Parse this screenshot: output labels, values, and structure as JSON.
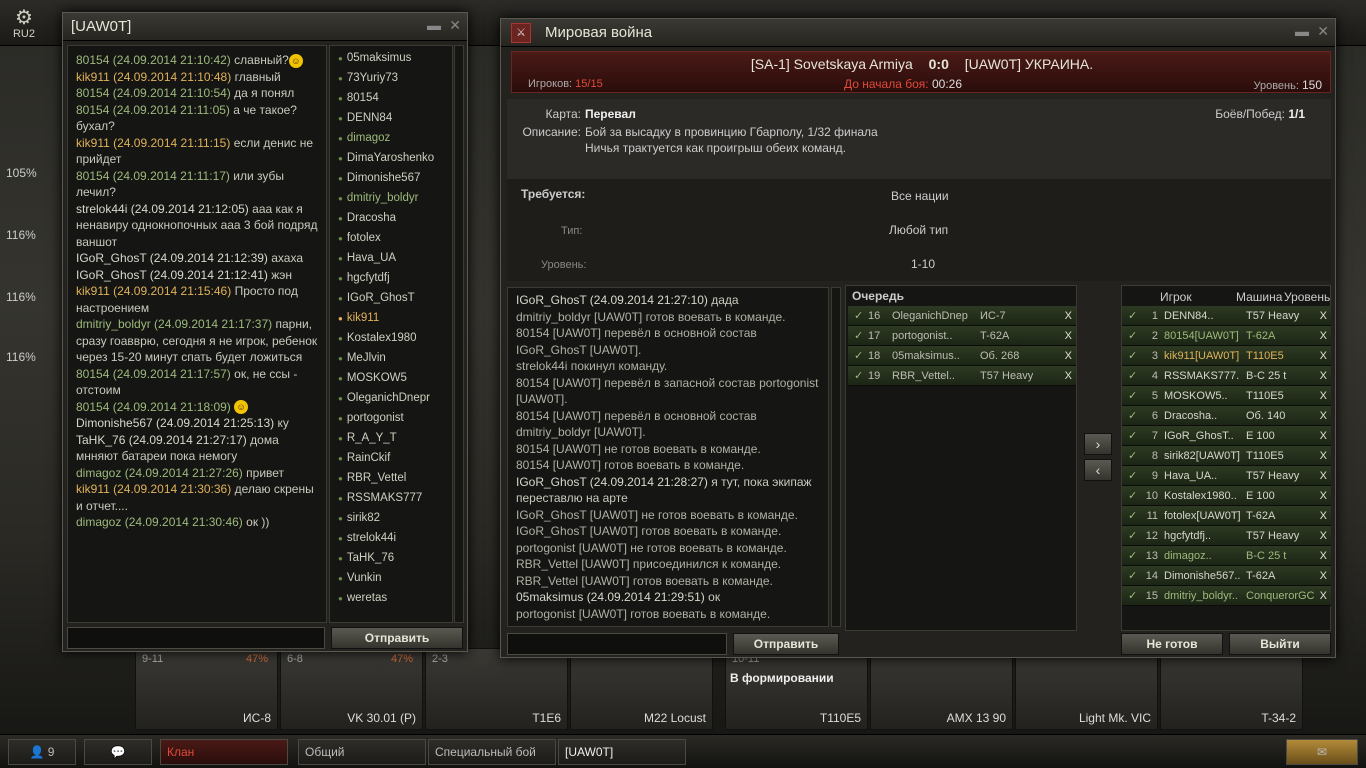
{
  "hangar": {
    "server": "RU2",
    "percents": [
      "105%",
      "116%",
      "116%",
      "116%"
    ],
    "carousel": [
      {
        "level": "9-11",
        "pct": "47%",
        "name": "ИС-8"
      },
      {
        "level": "6-8",
        "pct": "47%",
        "name": "VK 30.01 (P)"
      },
      {
        "level": "2-3",
        "pct": "",
        "name": "T1E6"
      },
      {
        "level": "",
        "pct": "",
        "name": "M22 Locust"
      },
      {
        "level": "10-11",
        "pct": "",
        "name": "T110E5",
        "status": "В формировании"
      },
      {
        "level": "",
        "pct": "",
        "name": "AMX 13 90"
      },
      {
        "level": "",
        "pct": "",
        "name": "Light Mk. VIC"
      },
      {
        "level": "",
        "pct": "",
        "name": "T-34-2"
      }
    ]
  },
  "bottombar": {
    "contacts_count": "9",
    "tabs": [
      "Клан",
      "Общий",
      "Специальный бой",
      "[UAW0T]"
    ]
  },
  "chat_window": {
    "title": "[UAW0T]",
    "messages": [
      {
        "author": "80154 (24.09.2014 21:10:42)",
        "text": "славный?",
        "smile": true,
        "c": "g"
      },
      {
        "author": "kik911 (24.09.2014 21:10:48)",
        "text": "главный",
        "c": "o"
      },
      {
        "author": "80154 (24.09.2014 21:10:54)",
        "text": "да я понял",
        "c": "g"
      },
      {
        "author": "80154 (24.09.2014 21:11:05)",
        "text": "а че такое? бухал?",
        "c": "g"
      },
      {
        "author": "kik911 (24.09.2014 21:11:15)",
        "text": "если денис не прийдет",
        "c": "o"
      },
      {
        "author": "80154 (24.09.2014 21:11:17)",
        "text": "или зубы лечил?",
        "c": "g"
      },
      {
        "author": "strelok44i (24.09.2014 21:12:05)",
        "text": "ааа как я ненавиру однокнопочных ааа 3 бой подряд ваншот",
        "c": "w"
      },
      {
        "author": "IGoR_GhosT (24.09.2014 21:12:39)",
        "text": "ахаха",
        "c": "w"
      },
      {
        "author": "IGoR_GhosT (24.09.2014 21:12:41)",
        "text": "жэн",
        "c": "w"
      },
      {
        "author": "kik911 (24.09.2014 21:15:46)",
        "text": "Просто под настроением",
        "c": "o"
      },
      {
        "author": "dmitriy_boldyr (24.09.2014 21:17:37)",
        "text": "парни, сразу гоавврю, сегодня я не игрок, ребенок через 15-20 минут спать будет ложиться",
        "c": "g"
      },
      {
        "author": "80154 (24.09.2014 21:17:57)",
        "text": "ок, не ссы - отстоим",
        "c": "g"
      },
      {
        "author": "80154 (24.09.2014 21:18:09)",
        "text": "",
        "smile": true,
        "c": "g"
      },
      {
        "author": "Dimonishe567 (24.09.2014 21:25:13)",
        "text": "ку",
        "c": "w"
      },
      {
        "author": "TaHK_76 (24.09.2014 21:27:17)",
        "text": "дома мнняют батареи пока немогу",
        "c": "w"
      },
      {
        "author": "dimagoz (24.09.2014 21:27:26)",
        "text": "привет",
        "c": "g"
      },
      {
        "author": "kik911 (24.09.2014 21:30:36)",
        "text": "делаю скрены и отчет....",
        "c": "o"
      },
      {
        "author": "dimagoz (24.09.2014 21:30:46)",
        "text": "ок ))",
        "c": "g"
      }
    ],
    "users": [
      "05maksimus",
      "73Yuriy73",
      "80154",
      "DENN84",
      "dimagoz",
      "DimaYaroshenko",
      "Dimonishe567",
      "dmitriy_boldyr",
      "Dracosha",
      "fotolex",
      "Hava_UA",
      "hgcfytdfj",
      "IGoR_GhosT",
      "kik911",
      "Kostalex1980",
      "MeJlvin",
      "MOSKOW5",
      "OleganichDnepr",
      "portogonist",
      "R_A_Y_T",
      "RainCkif",
      "RBR_Vettel",
      "RSSMAKS777",
      "sirik82",
      "strelok44i",
      "TaHK_76",
      "Vunkin",
      "weretas"
    ],
    "send_label": "Отправить"
  },
  "war_window": {
    "title": "Мировая война",
    "team_left": "[SA-1] Sovetskaya Armiya",
    "score": "0:0",
    "team_right": "[UAW0T] УКРАИНА.",
    "players_label": "Игроков:",
    "players_value": "15/15",
    "countdown_label": "До начала боя:",
    "countdown_value": "00:26",
    "level_label": "Уровень:",
    "level_value": "150",
    "map_label": "Карта:",
    "map_value": "Перевал",
    "desc_label": "Описание:",
    "desc_value": "Бой за высадку в провинцию Гбарполу, 1/32 финала",
    "desc_value2": "Ничья трактуется как проигрыш обеих команд.",
    "battles_label": "Боёв/Побед:",
    "battles_value": "1/1",
    "req_label": "Требуется:",
    "req_value": "Все нации",
    "type_label": "Тип:",
    "type_value": "Любой тип",
    "levels_label": "Уровень:",
    "levels_value": "1-10",
    "log": [
      {
        "a": "IGoR_GhosT (24.09.2014 21:27:10)",
        "t": "дада",
        "c": "w"
      },
      {
        "a": "",
        "t": "dmitriy_boldyr [UAW0T] готов воевать в команде.",
        "c": "s"
      },
      {
        "a": "",
        "t": "80154 [UAW0T] перевёл в основной состав IGoR_GhosT [UAW0T].",
        "c": "s"
      },
      {
        "a": "",
        "t": "strelok44i покинул команду.",
        "c": "s"
      },
      {
        "a": "",
        "t": "80154 [UAW0T] перевёл в запасной состав portogonist [UAW0T].",
        "c": "s"
      },
      {
        "a": "",
        "t": "80154 [UAW0T] перевёл в основной состав dmitriy_boldyr [UAW0T].",
        "c": "s"
      },
      {
        "a": "",
        "t": "80154 [UAW0T] не готов воевать в команде.",
        "c": "s"
      },
      {
        "a": "",
        "t": "80154 [UAW0T] готов воевать в команде.",
        "c": "s"
      },
      {
        "a": "IGoR_GhosT (24.09.2014 21:28:27)",
        "t": "я тут, пока экипаж переставлю на арте",
        "c": "w"
      },
      {
        "a": "",
        "t": "IGoR_GhosT [UAW0T] не готов воевать в команде.",
        "c": "s"
      },
      {
        "a": "",
        "t": "IGoR_GhosT [UAW0T] готов воевать в команде.",
        "c": "s"
      },
      {
        "a": "",
        "t": "portogonist [UAW0T] не готов воевать в команде.",
        "c": "s"
      },
      {
        "a": "",
        "t": "RBR_Vettel [UAW0T] присоединился к команде.",
        "c": "s"
      },
      {
        "a": "",
        "t": "RBR_Vettel [UAW0T] готов воевать в команде.",
        "c": "s"
      },
      {
        "a": "05maksimus (24.09.2014 21:29:51)",
        "t": "ок",
        "c": "w"
      },
      {
        "a": "",
        "t": "portogonist [UAW0T] готов воевать в команде.",
        "c": "s"
      }
    ],
    "queue_title": "Очередь",
    "queue": [
      {
        "n": "16",
        "name": "OleganichDnepr..",
        "tank": "ИС-7"
      },
      {
        "n": "17",
        "name": "portogonist..",
        "tank": "T-62A"
      },
      {
        "n": "18",
        "name": "05maksimus..",
        "tank": "Об. 268"
      },
      {
        "n": "19",
        "name": "RBR_Vettel..",
        "tank": "T57 Heavy"
      }
    ],
    "roster_headers": [
      "Игрок",
      "Машина",
      "Уровень"
    ],
    "roster": [
      {
        "n": "1",
        "name": "DENN84..",
        "tank": "T57 Heavy",
        "c": "w"
      },
      {
        "n": "2",
        "name": "80154[UAW0T]",
        "tank": "T-62A",
        "c": "g"
      },
      {
        "n": "3",
        "name": "kik911[UAW0T]",
        "tank": "T110E5",
        "c": "o"
      },
      {
        "n": "4",
        "name": "RSSMAKS777..",
        "tank": "B-C 25 t",
        "c": "w"
      },
      {
        "n": "5",
        "name": "MOSKOW5..",
        "tank": "T110E5",
        "c": "w"
      },
      {
        "n": "6",
        "name": "Dracosha..",
        "tank": "Об. 140",
        "c": "w"
      },
      {
        "n": "7",
        "name": "IGoR_GhosT..",
        "tank": "E 100",
        "c": "w"
      },
      {
        "n": "8",
        "name": "sirik82[UAW0T]",
        "tank": "T110E5",
        "c": "w"
      },
      {
        "n": "9",
        "name": "Hava_UA..",
        "tank": "T57 Heavy",
        "c": "w"
      },
      {
        "n": "10",
        "name": "Kostalex1980..",
        "tank": "E 100",
        "c": "w"
      },
      {
        "n": "11",
        "name": "fotolex[UAW0T]",
        "tank": "T-62A",
        "c": "w"
      },
      {
        "n": "12",
        "name": "hgcfytdfj..",
        "tank": "T57 Heavy",
        "c": "w"
      },
      {
        "n": "13",
        "name": "dimagoz..",
        "tank": "B-C 25 t",
        "c": "g"
      },
      {
        "n": "14",
        "name": "Dimonishe567..",
        "tank": "T-62A",
        "c": "w"
      },
      {
        "n": "15",
        "name": "dmitriy_boldyr..",
        "tank": "ConquerorGC",
        "c": "g"
      }
    ],
    "send_label": "Отправить",
    "notready_label": "Не готов",
    "exit_label": "Выйти"
  },
  "colors": {
    "green": "#9dba7c",
    "orange": "#e0b25a",
    "red": "#d84a3a"
  }
}
